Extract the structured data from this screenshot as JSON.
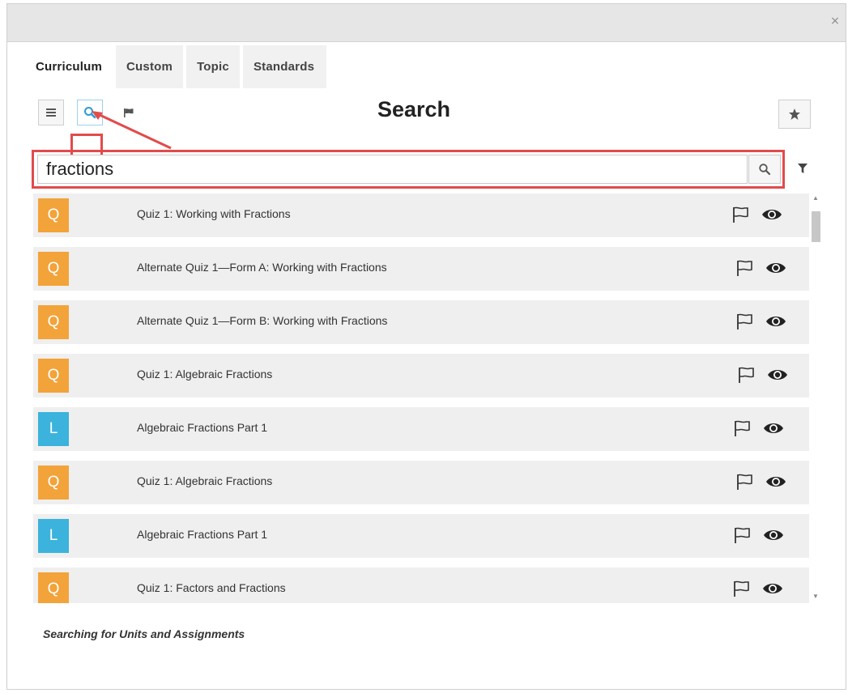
{
  "window": {
    "close_symbol": "×"
  },
  "tabs": [
    {
      "label": "Curriculum",
      "active": true
    },
    {
      "label": "Custom",
      "active": false
    },
    {
      "label": "Topic",
      "active": false
    },
    {
      "label": "Standards",
      "active": false
    }
  ],
  "toolbar": {
    "title": "Search",
    "icons": [
      "list-icon",
      "search-icon",
      "flag-icon",
      "star-icon"
    ]
  },
  "search": {
    "value": "fractions",
    "placeholder": "",
    "button_icon": "search-icon",
    "filter_icon": "filter-icon"
  },
  "results": [
    {
      "type": "Q",
      "title": "Quiz 1: Working with Fractions"
    },
    {
      "type": "Q",
      "title": "Alternate Quiz 1—Form A: Working with Fractions"
    },
    {
      "type": "Q",
      "title": "Alternate Quiz 1—Form B: Working with Fractions"
    },
    {
      "type": "Q",
      "title": "Quiz 1: Algebraic Fractions"
    },
    {
      "type": "L",
      "title": "Algebraic Fractions Part 1"
    },
    {
      "type": "Q",
      "title": "Quiz 1: Algebraic Fractions"
    },
    {
      "type": "L",
      "title": "Algebraic Fractions Part 1"
    },
    {
      "type": "Q",
      "title": "Quiz 1: Factors and Fractions"
    }
  ],
  "footer": {
    "note": "Searching for Units and Assignments"
  },
  "colors": {
    "quiz_badge": "#f2a33a",
    "lesson_badge": "#3bb3dc",
    "highlight": "#e24b4b",
    "active_icon": "#2b9bd6"
  }
}
